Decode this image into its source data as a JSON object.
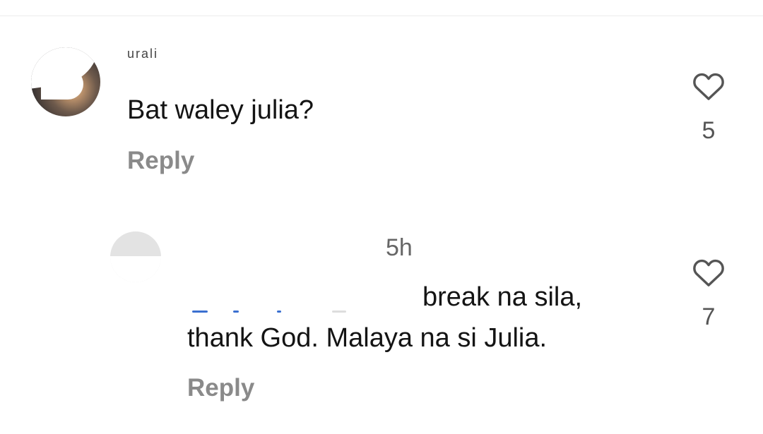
{
  "comments": [
    {
      "username": "urali",
      "text": "Bat waley julia?",
      "reply_label": "Reply",
      "like_count": "5"
    },
    {
      "time": "5h",
      "text_line1": "break na sila,",
      "text_line2": "thank God. Malaya na si Julia.",
      "reply_label": "Reply",
      "like_count": "7"
    }
  ],
  "icons": {
    "like": "heart-outline-icon"
  }
}
